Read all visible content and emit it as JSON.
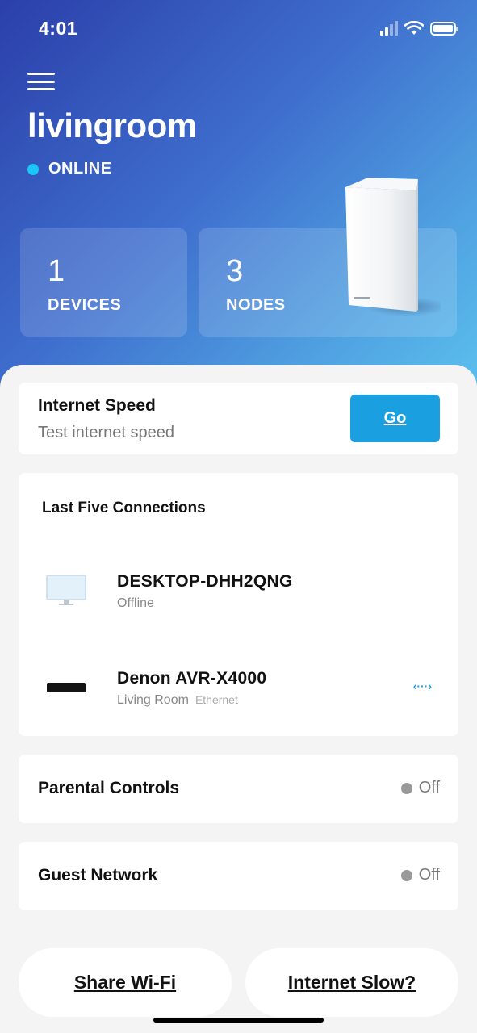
{
  "status_bar": {
    "time": "4:01",
    "icons": [
      "cellular-signal-icon",
      "wifi-icon",
      "battery-icon"
    ]
  },
  "header": {
    "menu_icon": "hamburger-menu-icon",
    "network_name": "livingroom",
    "status": "ONLINE",
    "status_color": "#19c6f5"
  },
  "stats": {
    "devices": {
      "count": "1",
      "label": "DEVICES"
    },
    "nodes": {
      "count": "3",
      "label": "NODES"
    }
  },
  "internet_speed": {
    "title": "Internet Speed",
    "subtitle": "Test internet speed",
    "button_label": "Go"
  },
  "connections": {
    "title": "Last Five Connections",
    "items": [
      {
        "name": "DESKTOP-DHH2QNG",
        "status": "Offline",
        "icon": "monitor-icon"
      },
      {
        "name": "Denon AVR-X4000",
        "location": "Living Room",
        "connection_type": "Ethernet",
        "icon": "av-receiver-icon",
        "connection_icon": "ethernet-icon"
      }
    ]
  },
  "parental_controls": {
    "title": "Parental Controls",
    "state": "Off"
  },
  "guest_network": {
    "title": "Guest Network",
    "state": "Off"
  },
  "actions": {
    "share_wifi": "Share Wi-Fi",
    "internet_slow": "Internet Slow?"
  },
  "colors": {
    "accent": "#1aa0e0",
    "hero_gradient_start": "#2b3faa",
    "hero_gradient_end": "#5cc2ef"
  }
}
